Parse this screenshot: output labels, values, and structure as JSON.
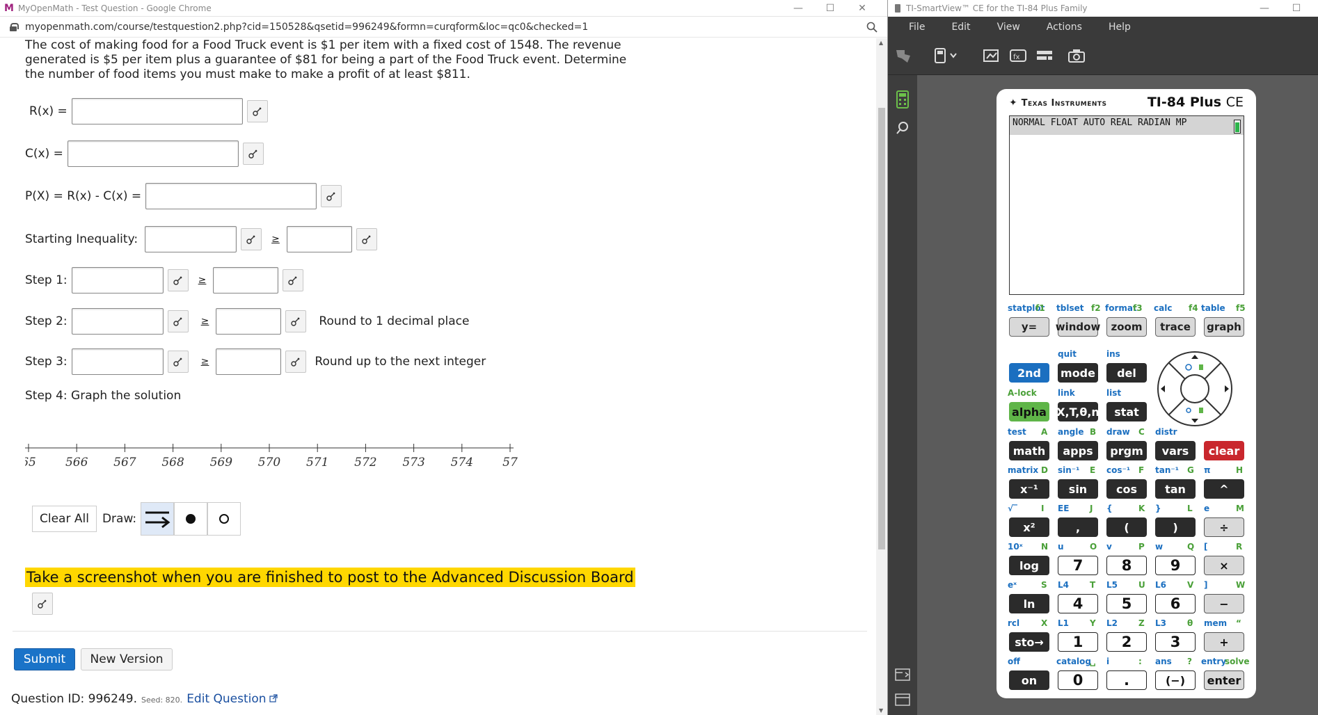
{
  "chrome": {
    "title": "MyOpenMath - Test Question - Google Chrome",
    "url": "myopenmath.com/course/testquestion2.php?cid=150528&qsetid=996249&formn=curqform&loc=qc0&checked=1"
  },
  "question": {
    "text": "The cost of making food for a Food Truck event is $1 per item with a fixed cost of 1548.  The revenue generated is $5 per item plus a guarantee of $81 for being a part of the Food Truck event.  Determine the number of food items you must make to make a profit of at least $811.",
    "r_label": "R(x) =",
    "c_label": "C(x) =",
    "p_label": "P(X) = R(x) - C(x) =",
    "ineq_label": "Starting Inequality:",
    "geq": "≥",
    "step1_label": "Step 1:",
    "step2_label": "Step 2:",
    "step2_note": "Round to 1 decimal place",
    "step3_label": "Step 3:",
    "step3_note": "Round up to the next integer",
    "step4_label": "Step 4: Graph the solution",
    "ticks": [
      "65",
      "566",
      "567",
      "568",
      "569",
      "570",
      "571",
      "572",
      "573",
      "574",
      "57"
    ],
    "clear_all": "Clear All",
    "draw_label": "Draw:",
    "highlight": "Take a screenshot when you are finished to post to the Advanced Discussion Board",
    "submit": "Submit",
    "new_version": "New Version",
    "qid_label": "Question ID: 996249.",
    "seed": "Seed: 820.",
    "edit": "Edit Question"
  },
  "ti": {
    "title": "TI-SmartView™ CE for the TI-84 Plus Family",
    "menu": [
      "File",
      "Edit",
      "View",
      "Actions",
      "Help"
    ],
    "brand": "Texas Instruments",
    "model": "TI-84 Plus",
    "model_suffix": "CE",
    "status": "NORMAL FLOAT AUTO REAL RADIAN MP",
    "fn_labels": [
      "statplot",
      "f1",
      "tblset",
      "f2",
      "format",
      "f3",
      "calc",
      "f4",
      "table",
      "f5"
    ],
    "fn_keys": [
      "y=",
      "window",
      "zoom",
      "trace",
      "graph"
    ],
    "keys": {
      "second": "2nd",
      "mode": "mode",
      "del": "del",
      "quit": "quit",
      "ins": "ins",
      "alock": "A-lock",
      "link": "link",
      "list": "list",
      "alpha": "alpha",
      "xt": "X,T,θ,n",
      "stat": "stat",
      "test": "test",
      "A": "A",
      "angle": "angle",
      "B": "B",
      "draw": "draw",
      "C": "C",
      "distr": "distr",
      "math": "math",
      "apps": "apps",
      "prgm": "prgm",
      "vars": "vars",
      "clear": "clear",
      "matrix": "matrix",
      "D": "D",
      "sin1": "sin⁻¹",
      "E": "E",
      "cos1": "cos⁻¹",
      "F": "F",
      "tan1": "tan⁻¹",
      "G": "G",
      "pi": "π",
      "H": "H",
      "xinv": "x⁻¹",
      "sin": "sin",
      "cos": "cos",
      "tan": "tan",
      "caret": "^",
      "sqrt": "√‾",
      "I": "I",
      "EE": "EE",
      "J": "J",
      "lbrace": "{",
      "K": "K",
      "rbrace": "}",
      "L": "L",
      "e": "e",
      "M": "M",
      "x2": "x²",
      "comma": ",",
      "lparen": "(",
      "rparen": ")",
      "div": "÷",
      "tenx": "10ˣ",
      "N": "N",
      "u": "u",
      "O": "O",
      "v": "v",
      "P": "P",
      "w": "w",
      "Q": "Q",
      "lbrack": "[",
      "R": "R",
      "log": "log",
      "k7": "7",
      "k8": "8",
      "k9": "9",
      "mul": "×",
      "ex": "eˣ",
      "S": "S",
      "L4": "L4",
      "T": "T",
      "L5": "L5",
      "U": "U",
      "L6": "L6",
      "V": "V",
      "rbrack": "]",
      "W": "W",
      "ln": "ln",
      "k4": "4",
      "k5": "5",
      "k6": "6",
      "minus": "−",
      "rcl": "rcl",
      "X": "X",
      "L1": "L1",
      "Y": "Y",
      "L2": "L2",
      "Z": "Z",
      "L3": "L3",
      "theta": "θ",
      "mem": "mem",
      "quote": "“",
      "sto": "sto→",
      "k1": "1",
      "k2": "2",
      "k3": "3",
      "plus": "+",
      "off": "off",
      "catalog": "catalog",
      "space": "␣",
      "i": "i",
      "colon": ":",
      "ans": "ans",
      "qmark": "?",
      "entry": "entry",
      "solve": "solve",
      "on": "on",
      "k0": "0",
      "dot": ".",
      "neg": "(−)",
      "enter": "enter"
    }
  }
}
